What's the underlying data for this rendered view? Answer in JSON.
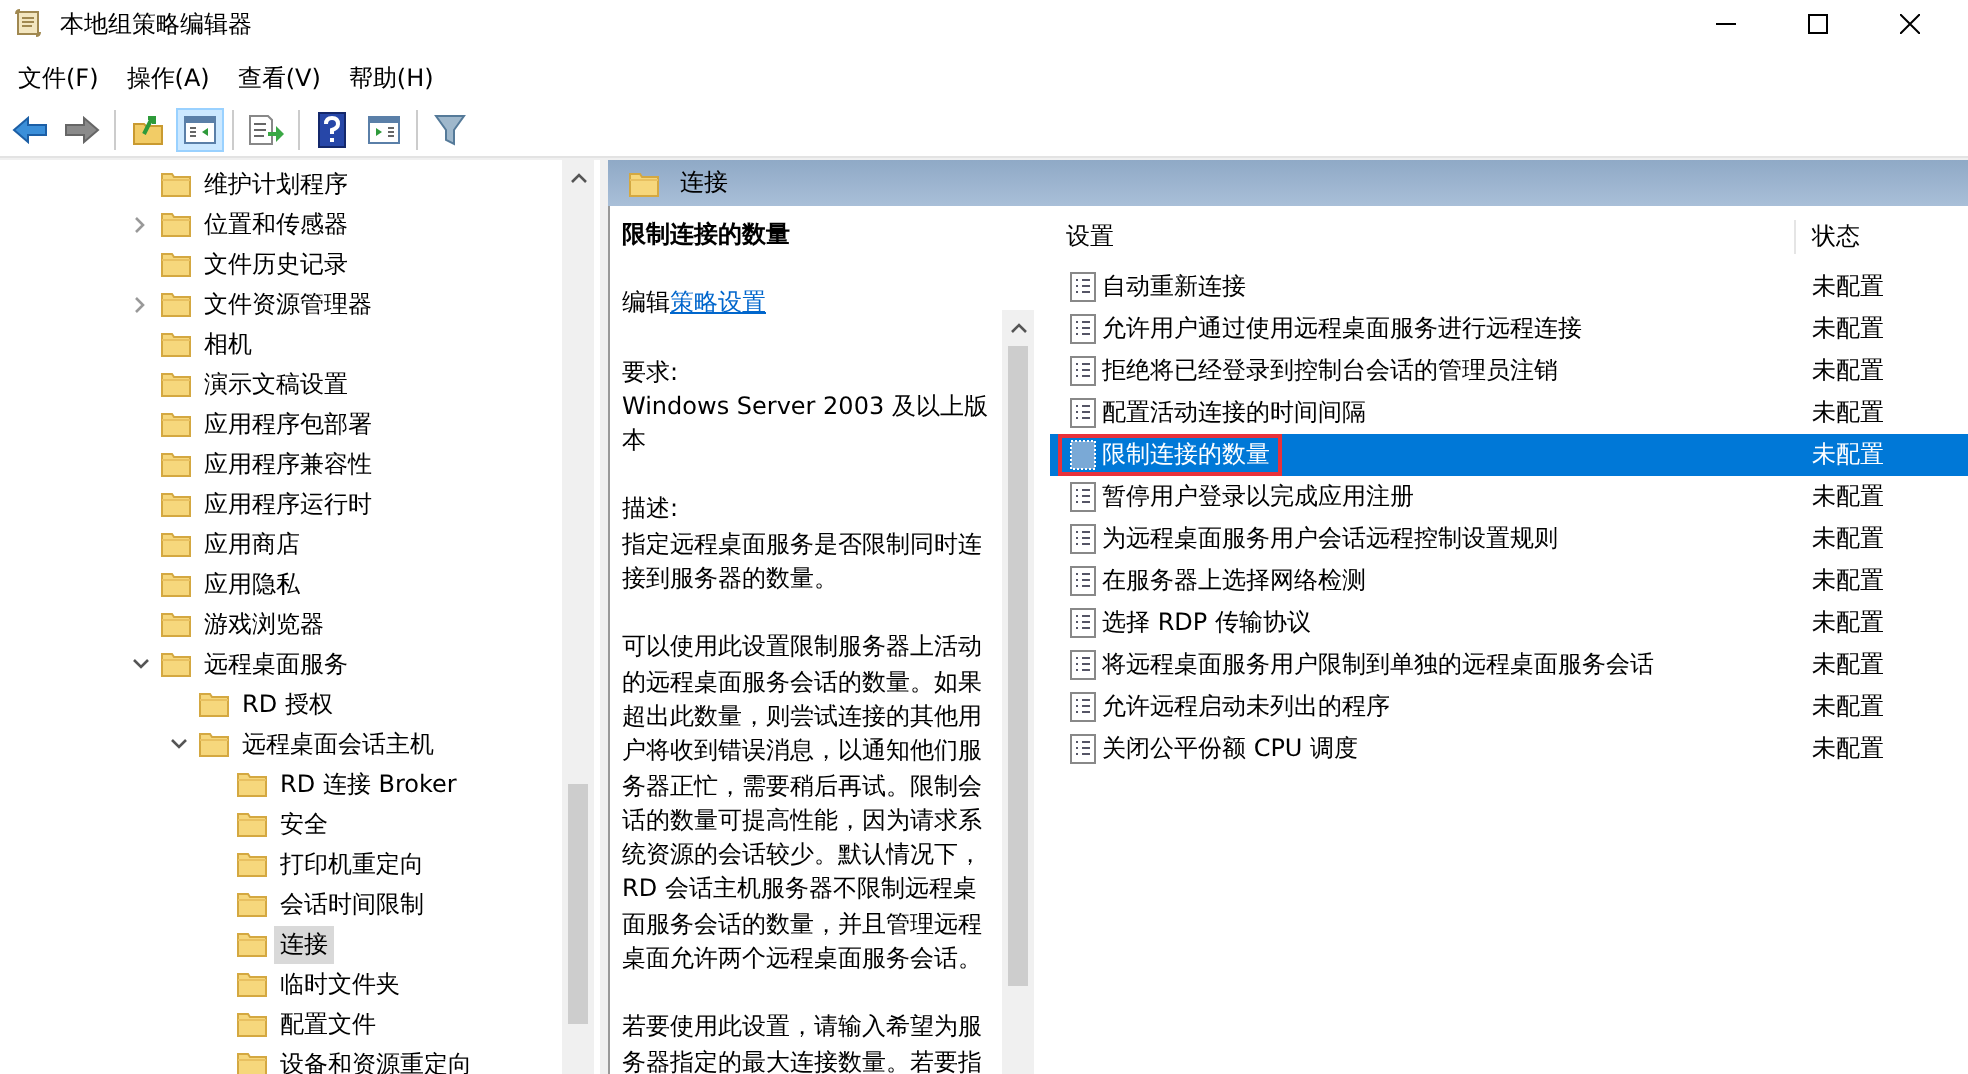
{
  "window": {
    "title": "本地组策略编辑器"
  },
  "menu": [
    "文件(F)",
    "操作(A)",
    "查看(V)",
    "帮助(H)"
  ],
  "toolbar": [
    [
      {
        "kind": "back",
        "pressed": false
      },
      {
        "kind": "forward",
        "pressed": false
      }
    ],
    [
      {
        "kind": "up",
        "pressed": false
      },
      {
        "kind": "tree",
        "pressed": true
      }
    ],
    [
      {
        "kind": "export",
        "pressed": false
      }
    ],
    [
      {
        "kind": "help",
        "pressed": false
      },
      {
        "kind": "pane",
        "pressed": false
      }
    ],
    [
      {
        "kind": "filter",
        "pressed": false
      }
    ]
  ],
  "tree": [
    {
      "label": "维护计划程序",
      "selected": false
    },
    {
      "label": "位置和传感器",
      "expanded": false,
      "selected": false
    },
    {
      "label": "文件历史记录",
      "selected": false
    },
    {
      "label": "文件资源管理器",
      "expanded": false,
      "selected": false
    },
    {
      "label": "相机",
      "selected": false
    },
    {
      "label": "演示文稿设置",
      "selected": false
    },
    {
      "label": "应用程序包部署",
      "selected": false
    },
    {
      "label": "应用程序兼容性",
      "selected": false
    },
    {
      "label": "应用程序运行时",
      "selected": false
    },
    {
      "label": "应用商店",
      "selected": false
    },
    {
      "label": "应用隐私",
      "selected": false
    },
    {
      "label": "游戏浏览器",
      "selected": false
    },
    {
      "label": "远程桌面服务",
      "expanded": true,
      "selected": false,
      "children": [
        {
          "label": "RD 授权",
          "selected": false
        },
        {
          "label": "远程桌面会话主机",
          "expanded": true,
          "selected": false,
          "children": [
            {
              "label": "RD 连接 Broker",
              "selected": false
            },
            {
              "label": "安全",
              "selected": false
            },
            {
              "label": "打印机重定向",
              "selected": false
            },
            {
              "label": "会话时间限制",
              "selected": false
            },
            {
              "label": "连接",
              "selected": true
            },
            {
              "label": "临时文件夹",
              "selected": false
            },
            {
              "label": "配置文件",
              "selected": false
            },
            {
              "label": "设备和资源重定向",
              "selected": false
            }
          ]
        }
      ]
    }
  ],
  "header": {
    "title": "连接"
  },
  "description": {
    "title": "限制连接的数量",
    "edit_prefix": "编辑",
    "edit_link": "策略设置",
    "requirements_label": "要求:",
    "requirements": "Windows Server 2003 及以上版本",
    "description_label": "描述:",
    "paragraphs": [
      "指定远程桌面服务是否限制同时连接到服务器的数量。",
      "可以使用此设置限制服务器上活动的远程桌面服务会话的数量。如果超出此数量，则尝试连接的其他用户将收到错误消息，以通知他们服务器正忙，需要稍后再试。限制会话的数量可提高性能，因为请求系统资源的会话较少。默认情况下，RD 会话主机服务器不限制远程桌面服务会话的数量，并且管理远程桌面允许两个远程桌面服务会话。",
      "若要使用此设置，请输入希望为服务器指定的最大连接数量。若要指"
    ]
  },
  "table": {
    "columns": [
      "设置",
      "状态"
    ],
    "rows": [
      {
        "setting": "自动重新连接",
        "status": "未配置",
        "selected": false,
        "annotated": false
      },
      {
        "setting": "允许用户通过使用远程桌面服务进行远程连接",
        "status": "未配置",
        "selected": false,
        "annotated": false
      },
      {
        "setting": "拒绝将已经登录到控制台会话的管理员注销",
        "status": "未配置",
        "selected": false,
        "annotated": false
      },
      {
        "setting": "配置活动连接的时间间隔",
        "status": "未配置",
        "selected": false,
        "annotated": false
      },
      {
        "setting": "限制连接的数量",
        "status": "未配置",
        "selected": true,
        "annotated": true
      },
      {
        "setting": "暂停用户登录以完成应用注册",
        "status": "未配置",
        "selected": false,
        "annotated": false
      },
      {
        "setting": "为远程桌面服务用户会话远程控制设置规则",
        "status": "未配置",
        "selected": false,
        "annotated": false
      },
      {
        "setting": "在服务器上选择网络检测",
        "status": "未配置",
        "selected": false,
        "annotated": false
      },
      {
        "setting": "选择 RDP 传输协议",
        "status": "未配置",
        "selected": false,
        "annotated": false
      },
      {
        "setting": "将远程桌面服务用户限制到单独的远程桌面服务会话",
        "status": "未配置",
        "selected": false,
        "annotated": false
      },
      {
        "setting": "允许远程启动未列出的程序",
        "status": "未配置",
        "selected": false,
        "annotated": false
      },
      {
        "setting": "关闭公平份额 CPU 调度",
        "status": "未配置",
        "selected": false,
        "annotated": false
      }
    ]
  }
}
